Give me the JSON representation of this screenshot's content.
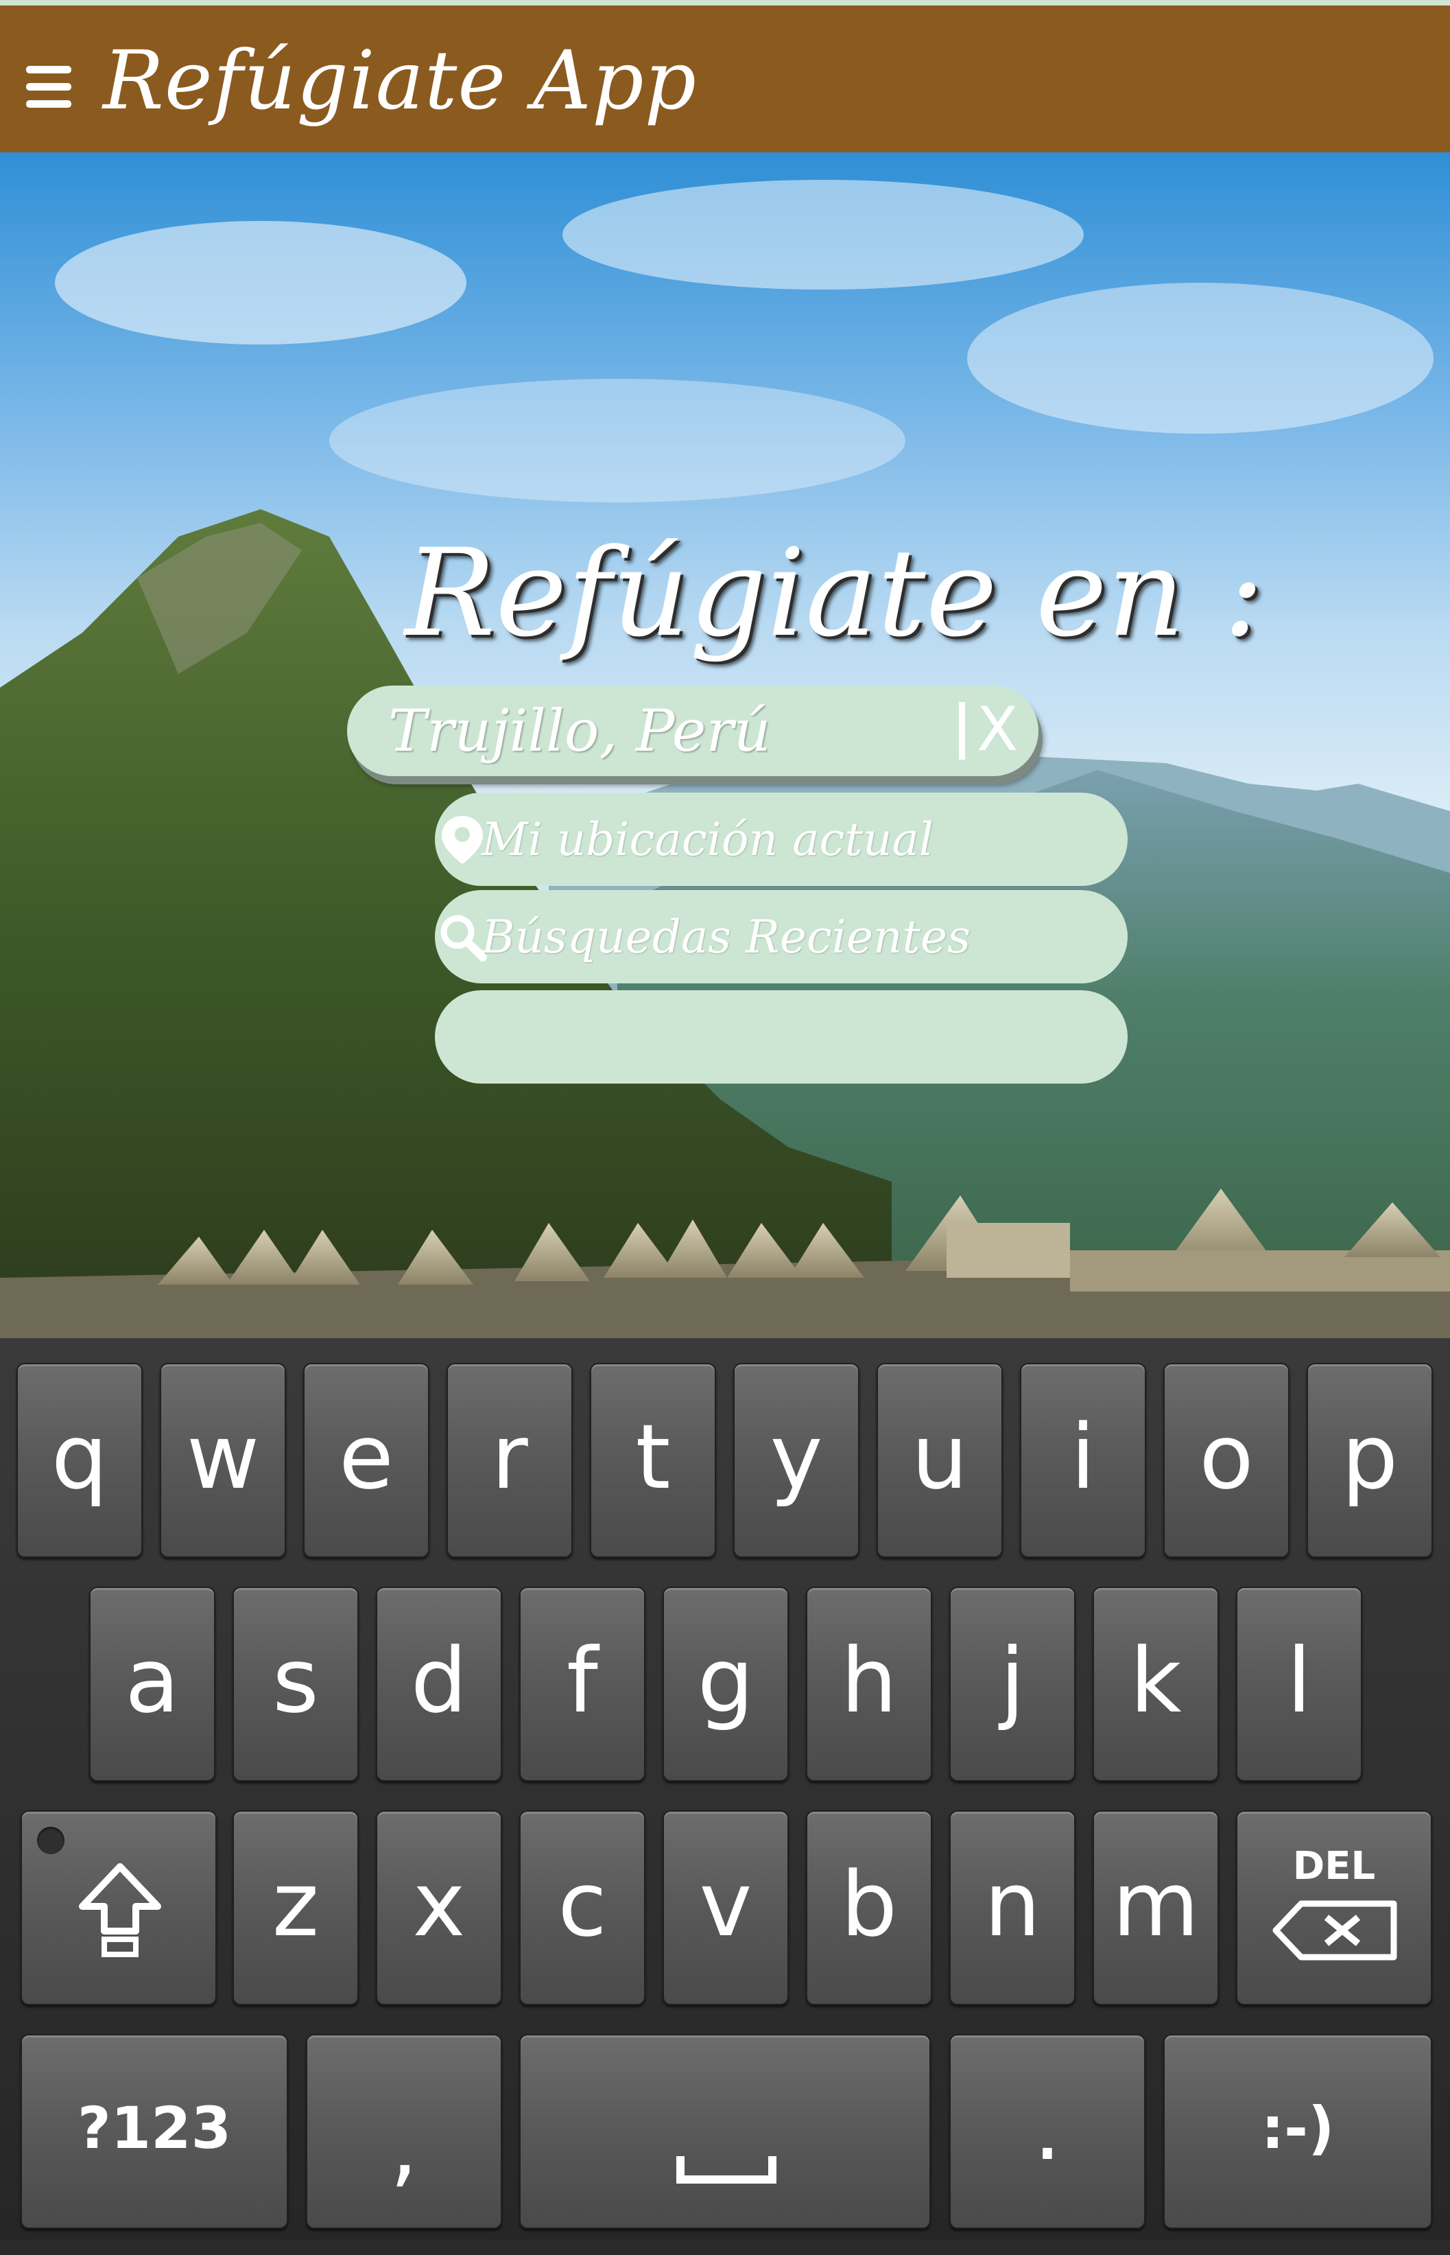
{
  "header": {
    "app_title": "Refúgiate App",
    "menu_icon": "hamburger-menu-icon",
    "color": "#8b5a1f"
  },
  "search": {
    "heading": "Refúgiate en :",
    "input_value": "Trujillo, Perú",
    "clear_label": "X",
    "options": [
      {
        "label": "Mi ubicación actual",
        "icon": "location-pin-icon"
      },
      {
        "label": "Búsquedas Recientes",
        "icon": "search-icon"
      },
      {
        "label": ""
      }
    ],
    "pill_color": "#cde6d4"
  },
  "keyboard": {
    "row1": [
      "q",
      "w",
      "e",
      "r",
      "t",
      "y",
      "u",
      "i",
      "o",
      "p"
    ],
    "row2": [
      "a",
      "s",
      "d",
      "f",
      "g",
      "h",
      "j",
      "k",
      "l"
    ],
    "row3": [
      "z",
      "x",
      "c",
      "v",
      "b",
      "n",
      "m"
    ],
    "shift_icon": "shift-arrow-icon",
    "delete_label": "DEL",
    "delete_icon": "backspace-icon",
    "symbols_label": "?123",
    "comma_label": ",",
    "space_icon": "space-bar-icon",
    "period_label": ".",
    "emoticon_label": ":-)"
  }
}
